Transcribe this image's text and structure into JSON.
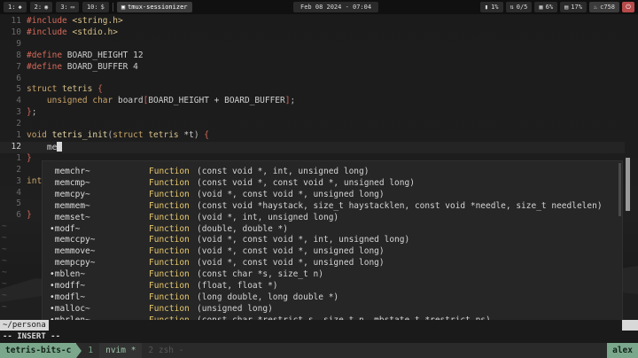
{
  "topbar": {
    "workspaces": [
      {
        "num": "1:",
        "icon": "◆"
      },
      {
        "num": "2:",
        "icon": "◉"
      },
      {
        "num": "3:",
        "icon": "▭"
      },
      {
        "num": "10:",
        "icon": "$"
      }
    ],
    "active_window": "tmux-sessionizer",
    "clock": "Feb 08 2024 - 07:04",
    "tray": [
      {
        "icon": "▮",
        "label": "1%"
      },
      {
        "icon": "⇅",
        "label": "0/5"
      },
      {
        "icon": "▦",
        "label": "6%"
      },
      {
        "icon": "▤",
        "label": "17%"
      },
      {
        "icon": "♨",
        "label": "c758"
      }
    ]
  },
  "editor": {
    "lines": [
      {
        "num": "11",
        "tokens": [
          [
            "pp",
            "#include "
          ],
          [
            "ty",
            "<string.h>"
          ]
        ]
      },
      {
        "num": "10",
        "tokens": [
          [
            "pp",
            "#include "
          ],
          [
            "ty",
            "<stdio.h>"
          ]
        ]
      },
      {
        "num": "9",
        "tokens": []
      },
      {
        "num": "8",
        "tokens": [
          [
            "pp",
            "#define "
          ],
          [
            "id",
            "BOARD_HEIGHT 12"
          ]
        ]
      },
      {
        "num": "7",
        "tokens": [
          [
            "pp",
            "#define "
          ],
          [
            "id",
            "BOARD_BUFFER 4"
          ]
        ]
      },
      {
        "num": "6",
        "tokens": []
      },
      {
        "num": "5",
        "tokens": [
          [
            "kw",
            "struct "
          ],
          [
            "ty",
            "tetris "
          ],
          [
            "pp",
            "{"
          ]
        ]
      },
      {
        "num": "4",
        "tokens": [
          [
            "id",
            "    "
          ],
          [
            "kw",
            "unsigned char "
          ],
          [
            "id",
            "board"
          ],
          [
            "pp",
            "["
          ],
          [
            "id",
            "BOARD_HEIGHT + BOARD_BUFFER"
          ],
          [
            "pp",
            "]"
          ],
          [
            "punct",
            ";"
          ]
        ]
      },
      {
        "num": "3",
        "tokens": [
          [
            "pp",
            "}"
          ],
          [
            "punct",
            ";"
          ]
        ]
      },
      {
        "num": "2",
        "tokens": []
      },
      {
        "num": "1",
        "tokens": [
          [
            "kw",
            "void "
          ],
          [
            "fn",
            "tetris_init"
          ],
          [
            "punct",
            "("
          ],
          [
            "kw",
            "struct "
          ],
          [
            "ty",
            "tetris "
          ],
          [
            "id",
            "*t"
          ],
          [
            "punct",
            ") "
          ],
          [
            "pp",
            "{"
          ]
        ]
      },
      {
        "num": "12",
        "current": true,
        "tokens": [
          [
            "id",
            "    me"
          ]
        ]
      },
      {
        "num": "1",
        "tokens": [
          [
            "pp",
            "}"
          ]
        ]
      },
      {
        "num": "2",
        "tokens": []
      },
      {
        "num": "3",
        "tokens": [
          [
            "kw",
            "int"
          ]
        ]
      },
      {
        "num": "4",
        "tokens": []
      },
      {
        "num": "5",
        "tokens": []
      },
      {
        "num": "6",
        "tokens": [
          [
            "pp",
            "}"
          ]
        ]
      }
    ]
  },
  "completion": {
    "items": [
      {
        "word": " memchr~",
        "kind": "Function",
        "info": "(const void *, int, unsigned long)"
      },
      {
        "word": " memcmp~",
        "kind": "Function",
        "info": "(const void *, const void *, unsigned long)"
      },
      {
        "word": " memcpy~",
        "kind": "Function",
        "info": "(void *, const void *, unsigned long)"
      },
      {
        "word": " memmem~",
        "kind": "Function",
        "info": "(const void *haystack, size_t haystacklen, const void *needle, size_t needlelen)"
      },
      {
        "word": " memset~",
        "kind": "Function",
        "info": "(void *, int, unsigned long)"
      },
      {
        "word": "•modf~",
        "kind": "Function",
        "info": "(double, double *)"
      },
      {
        "word": " memccpy~",
        "kind": "Function",
        "info": "(void *, const void *, int, unsigned long)"
      },
      {
        "word": " memmove~",
        "kind": "Function",
        "info": "(void *, const void *, unsigned long)"
      },
      {
        "word": " mempcpy~",
        "kind": "Function",
        "info": "(void *, const void *, unsigned long)"
      },
      {
        "word": "•mblen~",
        "kind": "Function",
        "info": "(const char *s, size_t n)"
      },
      {
        "word": "•modff~",
        "kind": "Function",
        "info": "(float, float *)"
      },
      {
        "word": "•modfl~",
        "kind": "Function",
        "info": "(long double, long double *)"
      },
      {
        "word": "•malloc~",
        "kind": "Function",
        "info": "(unsigned long)"
      },
      {
        "word": "•mbrlen~",
        "kind": "Function",
        "info": "(const char *restrict s, size_t n, mbstate_t *restrict ps)"
      }
    ]
  },
  "statusline": {
    "path": "~/persona"
  },
  "mode": "-- INSERT --",
  "tmux": {
    "session": "tetris-bits-c",
    "windows": [
      {
        "label": "1",
        "active": false
      },
      {
        "label": "nvim *",
        "active": true
      },
      {
        "label": "2 zsh -",
        "active": false
      }
    ],
    "user": "alex"
  }
}
